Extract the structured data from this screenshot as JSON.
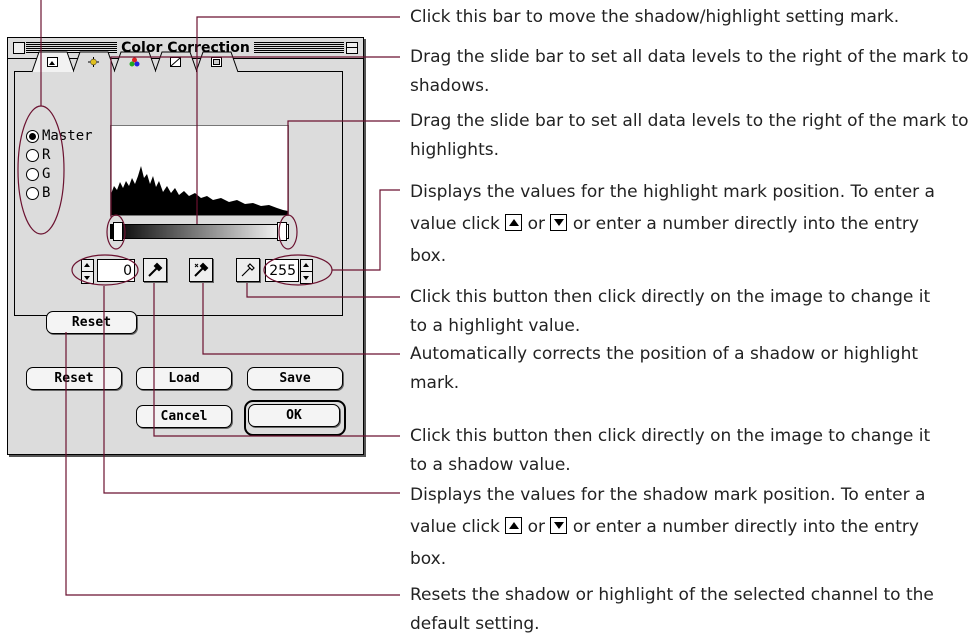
{
  "dialog": {
    "title": "Color Correction",
    "tabs": [
      "image-tab-icon",
      "brightness-tab-icon",
      "color-balance-tab-icon",
      "tone-curve-tab-icon",
      "monitor-tab-icon"
    ],
    "channels": [
      {
        "label": "Master",
        "selected": true
      },
      {
        "label": "R",
        "selected": false
      },
      {
        "label": "G",
        "selected": false
      },
      {
        "label": "B",
        "selected": false
      }
    ],
    "shadow_value": "0",
    "highlight_value": "255",
    "channel_reset_label": "Reset",
    "buttons": {
      "reset": "Reset",
      "load": "Load",
      "save": "Save",
      "cancel": "Cancel",
      "ok": "OK"
    }
  },
  "annotations": {
    "a1": "Click this bar to move the shadow/highlight setting mark.",
    "a2": "Drag the slide bar to set all data levels to the right of the mark to shadows.",
    "a3": "Drag the slide bar to set all data levels to the right of the mark to highlights.",
    "a4_pre": "Displays the values for the highlight mark position.  To enter a value click",
    "a4_or": "or",
    "a4_post": "or enter a number directly into the entry box.",
    "a5": "Click this button then click directly on the image to change it to a highlight value.",
    "a6": "Automatically corrects the position of a shadow or highlight mark.",
    "a7": "Click this button then click directly on the image to change it to a shadow value.",
    "a8_pre": "Displays the values for the shadow mark position.  To enter a value click",
    "a8_or": "or",
    "a8_post": "or enter a number directly into the entry box.",
    "a9": "Resets the shadow or highlight of the selected channel to the default setting."
  },
  "colors": {
    "callout_line": "#6b1230",
    "window_bg": "#dcdcdc"
  }
}
